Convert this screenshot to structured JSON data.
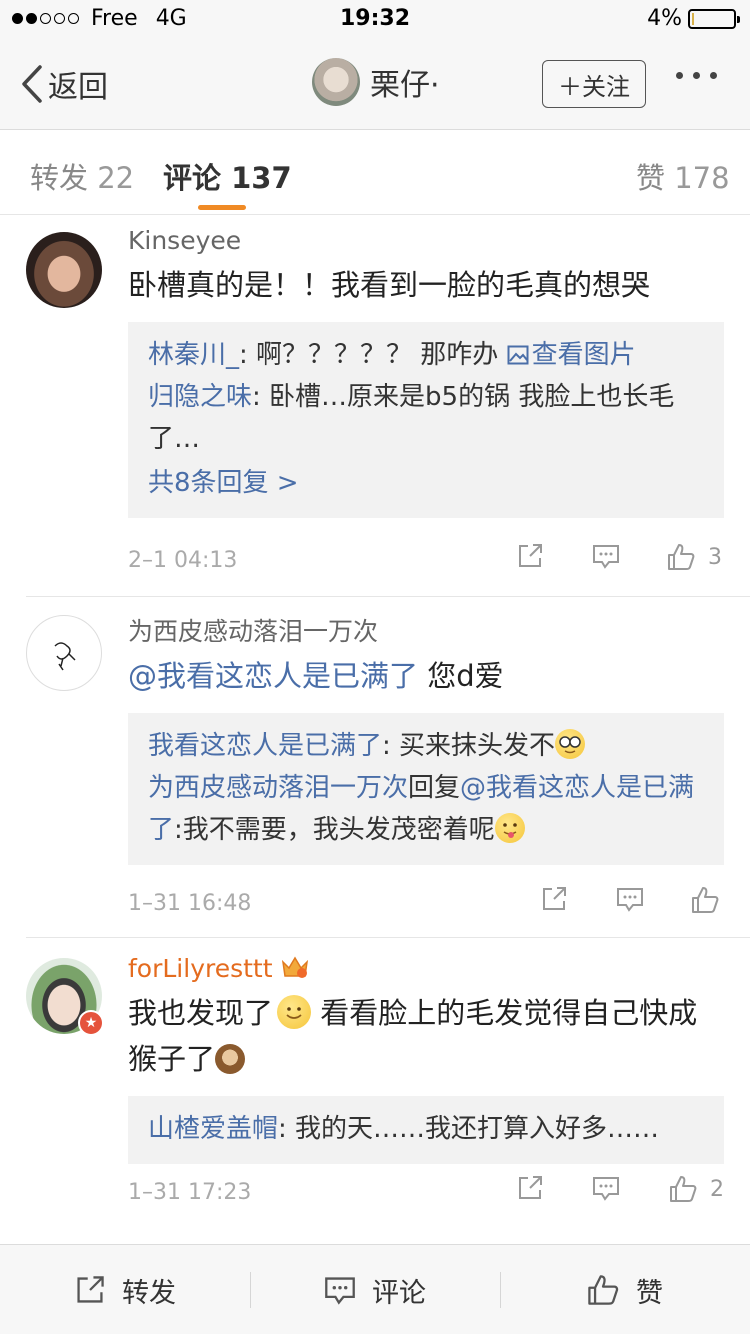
{
  "status_bar": {
    "carrier": "Free",
    "network": "4G",
    "time": "19:32",
    "battery": "4%",
    "battery_level": 0.04
  },
  "nav": {
    "back_label": "返回",
    "user_name": "栗仔·",
    "follow_label": "＋关注"
  },
  "tabs": {
    "repost_label": "转发",
    "repost_count": "22",
    "comment_label": "评论",
    "comment_count": "137",
    "like_label": "赞",
    "like_count": "178"
  },
  "comments": [
    {
      "user": "Kinseyee",
      "text": "卧槽真的是！！我看到一脸的毛真的想哭",
      "replies": [
        {
          "user": "林秦川_",
          "sep": ":",
          "text": " 啊？？？？？ 那咋办 ",
          "link": "查看图片"
        },
        {
          "user": "归隐之味",
          "sep": ":",
          "text": " 卧槽…原来是b5的锅 我脸上也长毛了…"
        }
      ],
      "more": "共8条回复 >",
      "time": "2–1 04:13",
      "likes": "3"
    },
    {
      "user": "为西皮感动落泪一万次",
      "mention": "@我看这恋人是已满了",
      "text": " 您d爱",
      "replies": [
        {
          "user": "我看这恋人是已满了",
          "sep": ":",
          "text": " 买来抹头发不"
        },
        {
          "user": "为西皮感动落泪一万次",
          "mid": "回复",
          "mention": "@我看这恋人是已满了",
          "text": ":我不需要，我头发茂密着呢"
        }
      ],
      "time": "1–31 16:48",
      "likes": ""
    },
    {
      "user": "forLilyresttt",
      "text_a": "我也发现了",
      "text_b": " 看看脸上的毛发觉得自己快成猴子了",
      "replies": [
        {
          "user": "山楂爱盖帽",
          "sep": ":",
          "text": " 我的天……我还打算入好多……"
        }
      ],
      "time": "1–31 17:23",
      "likes": "2"
    }
  ],
  "bottom_bar": {
    "repost": "转发",
    "comment": "评论",
    "like": "赞"
  },
  "colors": {
    "accent": "#f08a24",
    "link": "#4a6ea8",
    "vip_name": "#e46b1e"
  }
}
